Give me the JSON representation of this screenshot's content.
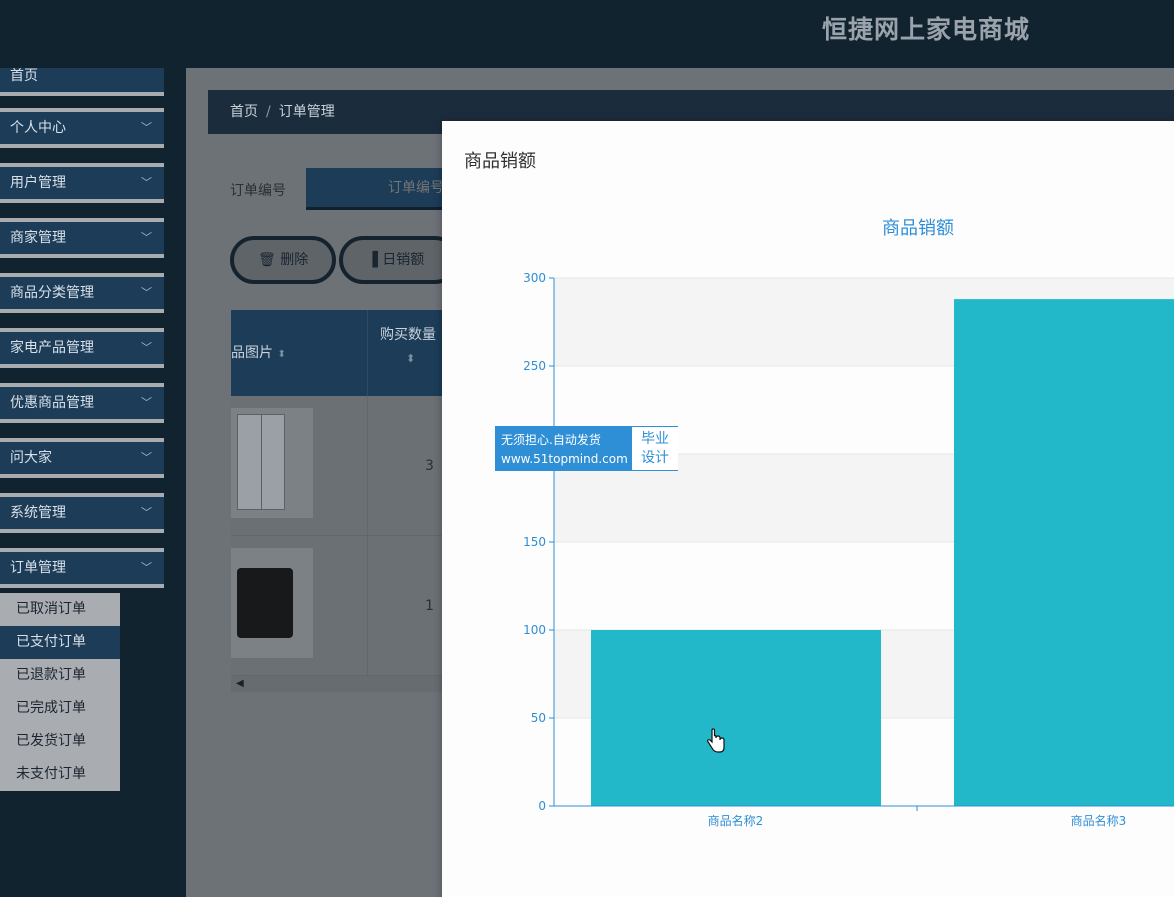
{
  "header": {
    "site_title": "恒捷网上家电商城"
  },
  "sidebar": {
    "items": [
      {
        "label": "首页",
        "expandable": false
      },
      {
        "label": "个人中心",
        "expandable": true
      },
      {
        "label": "用户管理",
        "expandable": true
      },
      {
        "label": "商家管理",
        "expandable": true
      },
      {
        "label": "商品分类管理",
        "expandable": true
      },
      {
        "label": "家电产品管理",
        "expandable": true
      },
      {
        "label": "优惠商品管理",
        "expandable": true
      },
      {
        "label": "问大家",
        "expandable": true
      },
      {
        "label": "系统管理",
        "expandable": true
      },
      {
        "label": "订单管理",
        "expandable": true
      }
    ],
    "submenu": [
      {
        "label": "已取消订单",
        "active": false
      },
      {
        "label": "已支付订单",
        "active": true
      },
      {
        "label": "已退款订单",
        "active": false
      },
      {
        "label": "已完成订单",
        "active": false
      },
      {
        "label": "已发货订单",
        "active": false
      },
      {
        "label": "未支付订单",
        "active": false
      }
    ]
  },
  "breadcrumb": {
    "home": "首页",
    "separator": "/",
    "current": "订单管理"
  },
  "search": {
    "label": "订单编号",
    "placeholder": "订单编号"
  },
  "toolbar": {
    "delete_label": "删除",
    "daily_sales_label": "日销额"
  },
  "table": {
    "headers": {
      "image": "品图片",
      "quantity": "购买数量"
    },
    "rows": [
      {
        "image": "fridge-image",
        "quantity": "3"
      },
      {
        "image": "coffee-maker-image",
        "quantity": "1"
      }
    ]
  },
  "modal": {
    "title": "商品销额"
  },
  "watermark": {
    "line1": "无须担心.自动发货",
    "line2": "www.51topmind.com",
    "badge_line1": "毕业",
    "badge_line2": "设计"
  },
  "chart_data": {
    "type": "bar",
    "title": "商品销额",
    "categories": [
      "商品名称2",
      "商品名称3"
    ],
    "values": [
      100,
      288
    ],
    "ylim": [
      0,
      300
    ],
    "yticks": [
      0,
      50,
      100,
      150,
      200,
      250,
      300
    ],
    "grid": true,
    "bar_color": "#22b7c9",
    "axis_color": "#2f8fd6"
  },
  "colors": {
    "header_bg": "#122330",
    "menu_bg": "#1c3c58",
    "accent": "#22b7c9"
  }
}
